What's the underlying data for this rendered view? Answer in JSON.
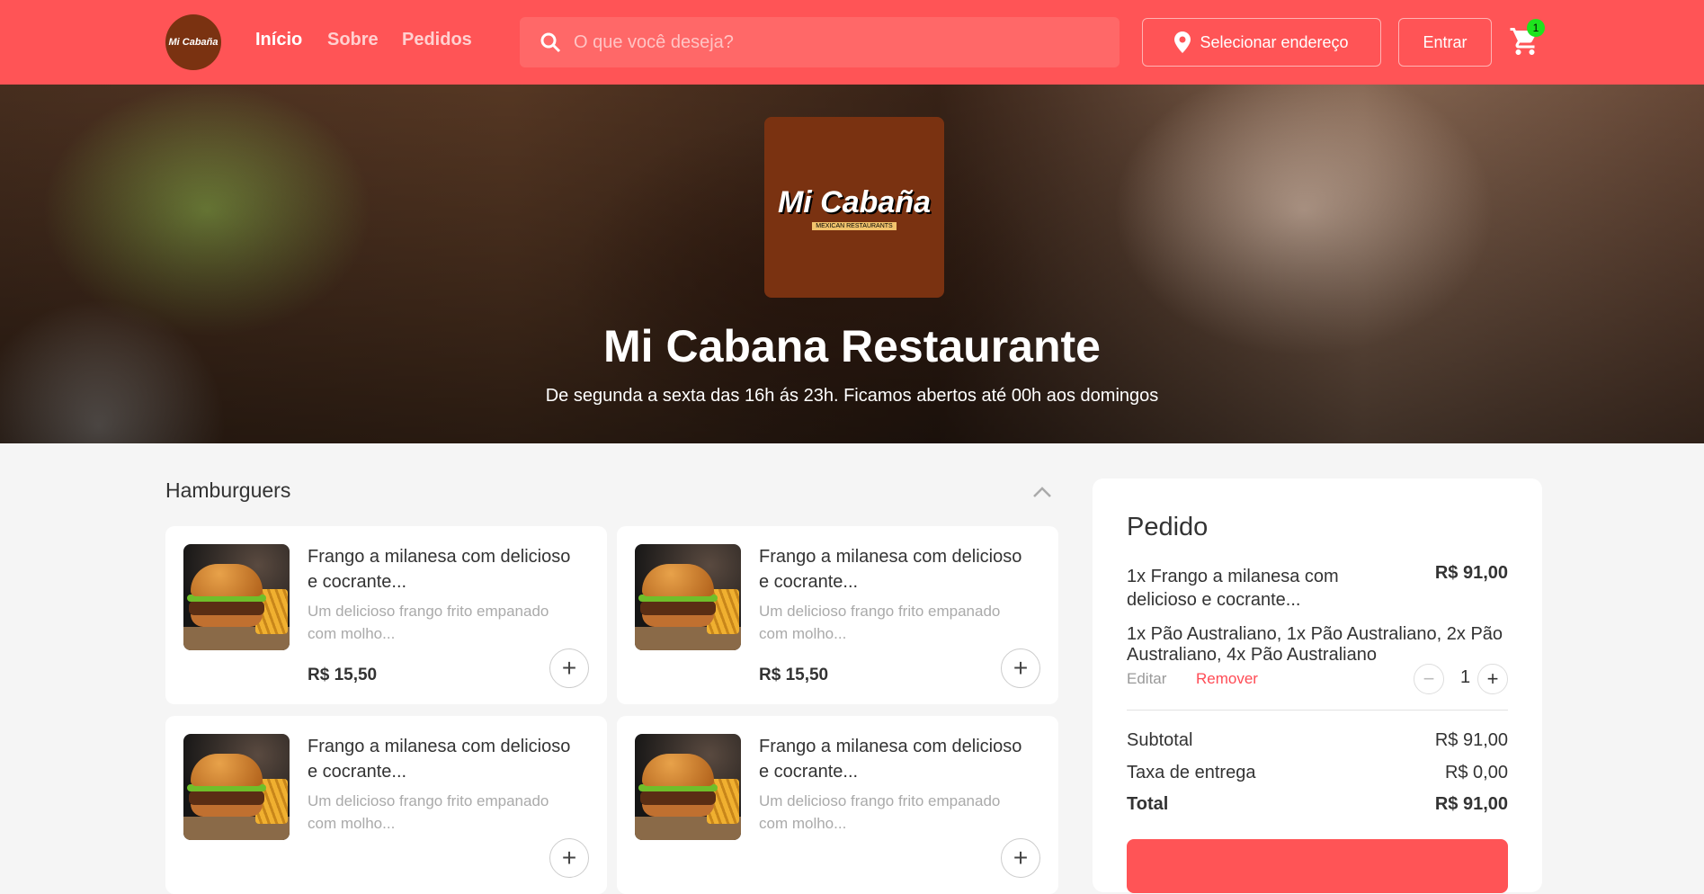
{
  "header": {
    "logo_text": "Mi Cabaña",
    "nav": [
      "Início",
      "Sobre",
      "Pedidos"
    ],
    "search_placeholder": "O que você deseja?",
    "address_button": "Selecionar endereço",
    "login_button": "Entrar",
    "cart_count": "1"
  },
  "hero": {
    "logo_text": "Mi Cabaña",
    "logo_subtext": "MEXICAN RESTAURANTS",
    "title": "Mi Cabana Restaurante",
    "subtitle": "De segunda a sexta das 16h ás 23h. Ficamos abertos até 00h aos domingos"
  },
  "menu": {
    "category": "Hamburguers",
    "products": [
      {
        "title": "Frango a milanesa com delicioso e cocrante...",
        "description": "Um delicioso frango frito empanado com molho...",
        "price": "R$ 15,50"
      },
      {
        "title": "Frango a milanesa com delicioso e cocrante...",
        "description": "Um delicioso frango frito empanado com molho...",
        "price": "R$ 15,50"
      },
      {
        "title": "Frango a milanesa com delicioso e cocrante...",
        "description": "Um delicioso frango frito empanado com molho...",
        "price": ""
      },
      {
        "title": "Frango a milanesa com delicioso e cocrante...",
        "description": "Um delicioso frango frito empanado com molho...",
        "price": ""
      }
    ]
  },
  "order": {
    "title": "Pedido",
    "item": {
      "name": "1x Frango a milanesa com delicioso e cocrante...",
      "price": "R$ 91,00",
      "extras": "1x Pão Australiano, 1x Pão Australiano, 2x Pão Australiano, 4x Pão Australiano",
      "edit": "Editar",
      "remove": "Remover",
      "quantity": "1"
    },
    "subtotal_label": "Subtotal",
    "subtotal": "R$ 91,00",
    "delivery_label": "Taxa de entrega",
    "delivery": "R$ 0,00",
    "total_label": "Total",
    "total": "R$ 91,00"
  },
  "colors": {
    "brand": "#ff5456",
    "badge": "#1ee31e"
  }
}
